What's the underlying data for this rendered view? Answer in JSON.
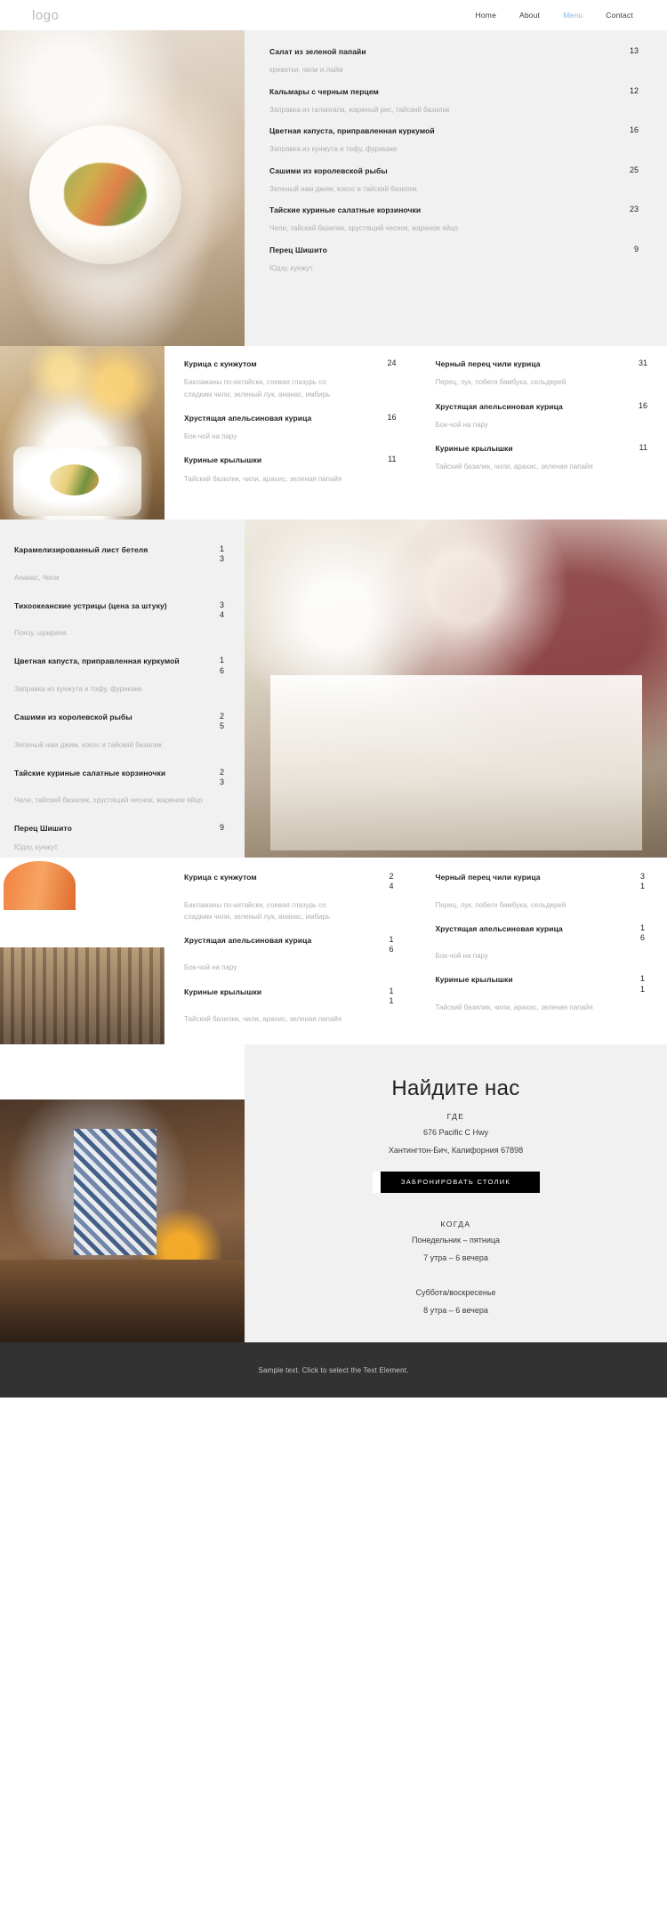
{
  "header": {
    "logo": "logo",
    "nav": [
      {
        "label": "Home",
        "active": false
      },
      {
        "label": "About",
        "active": false
      },
      {
        "label": "Menu",
        "active": true
      },
      {
        "label": "Contact",
        "active": false
      }
    ]
  },
  "section1": {
    "items": [
      {
        "name": "Салат из зеленой папайи",
        "price": "13",
        "desc": "креветки, чили и лайм"
      },
      {
        "name": "Кальмары с черным перцем",
        "price": "12",
        "desc": "Заправка из галангала, жареный рис, тайский базилик"
      },
      {
        "name": "Цветная капуста, приправленная куркумой",
        "price": "16",
        "desc": "Заправка из кунжута и тофу, фурикаке"
      },
      {
        "name": "Сашими из королевской рыбы",
        "price": "25",
        "desc": "Зеленый нам джим, кокос и тайский базилик"
      },
      {
        "name": "Тайские куриные салатные корзиночки",
        "price": "23",
        "desc": "Чили, тайский базилик, хрустящий чеснок, жареное яйцо"
      },
      {
        "name": "Перец Шишито",
        "price": "9",
        "desc": "Юдзу, кунжут"
      }
    ]
  },
  "section2": {
    "left": [
      {
        "name": "Курица с кунжутом",
        "price": "24",
        "desc": "Баклажаны по-китайски, соевая глазурь со сладким чили, зеленый лук, ананас, имбирь"
      },
      {
        "name": "Хрустящая апельсиновая курица",
        "price": "16",
        "desc": "Бок-чой на пару"
      },
      {
        "name": "Куриные крылышки",
        "price": "11",
        "desc": "Тайский базилик, чили, арахис, зеленая папайя"
      }
    ],
    "right": [
      {
        "name": "Черный перец чили курица",
        "price": "31",
        "desc": "Перец, лук, побеги бамбука, сельдерей"
      },
      {
        "name": "Хрустящая апельсиновая курица",
        "price": "16",
        "desc": "Бок-чой на пару"
      },
      {
        "name": "Куриные крылышки",
        "price": "11",
        "desc": "Тайский базилик, чили, арахис, зеленая папайя"
      }
    ]
  },
  "section3": {
    "items": [
      {
        "name": "Карамелизированный лист бетеля",
        "price": "13",
        "desc": "Ананас, Чили"
      },
      {
        "name": "Тихоокеанские устрицы (цена за штуку)",
        "price": "34",
        "desc": "Понзу, шрирача"
      },
      {
        "name": "Цветная капуста, приправленная куркумой",
        "price": "16",
        "desc": "Заправка из кунжута и тофу, фурикаке"
      },
      {
        "name": "Сашими из королевской рыбы",
        "price": "25",
        "desc": "Зеленый нам джим, кокос и тайский базилик"
      },
      {
        "name": "Тайские куриные салатные корзиночки",
        "price": "23",
        "desc": "Чили, тайский базилик, хрустящий чеснок, жареное яйцо"
      },
      {
        "name": "Перец Шишито",
        "price": "9",
        "desc": "Юдзу, кунжут"
      }
    ]
  },
  "section4": {
    "left": [
      {
        "name": "Курица с кунжутом",
        "price": "24",
        "desc": "Баклажаны по-китайски, соевая глазурь со сладким чили, зеленый лук, ананас, имбирь"
      },
      {
        "name": "Хрустящая апельсиновая курица",
        "price": "16",
        "desc": "Бок-чой на пару"
      },
      {
        "name": "Куриные крылышки",
        "price": "11",
        "desc": "Тайский базилик, чили, арахис, зеленая папайя"
      }
    ],
    "right": [
      {
        "name": "Черный перец чили курица",
        "price": "31",
        "desc": "Перец, лук, побеги бамбука, сельдерей"
      },
      {
        "name": "Хрустящая апельсиновая курица",
        "price": "16",
        "desc": "Бок-чой на пару"
      },
      {
        "name": "Куриные крылышки",
        "price": "11",
        "desc": "Тайский базилик, чили, арахис, зеленая папайя"
      }
    ]
  },
  "find_us": {
    "title": "Найдите нас",
    "where_label": "ГДЕ",
    "address_line1": "676 Pacific C Hwy",
    "address_line2": "Хантингтон-Бич, Калифорния 67898",
    "book_button": "ЗАБРОНИРОВАТЬ СТОЛИК",
    "when_label": "КОГДА",
    "weekday_days": "Понедельник – пятница",
    "weekday_hours": "7 утра – 6 вечера",
    "weekend_days": "Суббота/воскресенье",
    "weekend_hours": "8 утра – 6 вечера"
  },
  "footer": {
    "text": "Sample text. Click to select the Text Element."
  },
  "colors": {
    "accent": "#8fb4d9",
    "panel": "#f1f1f1",
    "footer_bg": "#323232",
    "button_bg": "#000000"
  }
}
